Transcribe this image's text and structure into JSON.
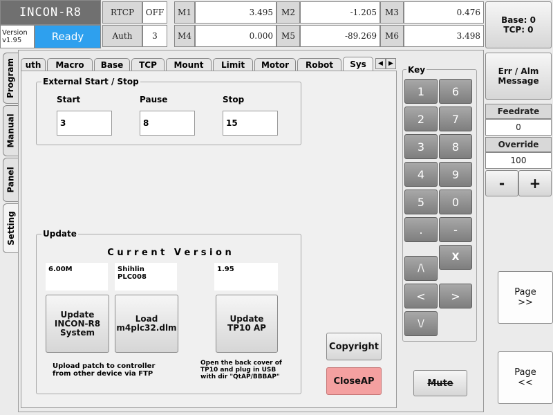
{
  "header": {
    "app_title": "INCON-R8",
    "version_label": "Version",
    "version": "v1.95",
    "status": "Ready",
    "rtcp_label": "RTCP",
    "rtcp_value": "OFF",
    "auth_label": "Auth",
    "auth_value": "3",
    "m1_label": "M1",
    "m1_value": "3.495",
    "m2_label": "M2",
    "m2_value": "-1.205",
    "m3_label": "M3",
    "m3_value": "0.476",
    "m4_label": "M4",
    "m4_value": "0.000",
    "m5_label": "M5",
    "m5_value": "-89.269",
    "m6_label": "M6",
    "m6_value": "3.498",
    "base_tcp": "Base: 0\nTCP: 0"
  },
  "side_tabs": [
    "Program",
    "Manual",
    "Panel",
    "Setting"
  ],
  "tabs": [
    "uth",
    "Macro",
    "Base",
    "TCP",
    "Mount",
    "Limit",
    "Motor",
    "Robot",
    "Sys"
  ],
  "external": {
    "title": "External Start / Stop",
    "start_label": "Start",
    "start_value": "3",
    "pause_label": "Pause",
    "pause_value": "8",
    "stop_label": "Stop",
    "stop_value": "15"
  },
  "update": {
    "title": "Update",
    "current_version": "C u r r e n t   V e r s i o n",
    "ver1": "6.00M",
    "ver2": "Shihlin PLC008",
    "ver3": "1.95",
    "btn1": "Update\nINCON-R8\nSystem",
    "btn2": "Load\nm4plc32.dlm",
    "btn3": "Update\nTP10 AP",
    "note1": "Upload patch to controller\nfrom other device via FTP",
    "note2": "Open the back cover of\nTP10 and plug in USB\nwith dir \"QtAP/BBBAP\""
  },
  "buttons": {
    "copyright": "Copyright",
    "close_ap": "CloseAP",
    "mute": "Mute"
  },
  "keypad": {
    "title": "Key",
    "keys": [
      "1",
      "6",
      "2",
      "7",
      "3",
      "8",
      "4",
      "9",
      "5",
      "0",
      ".",
      "-"
    ],
    "x": "X",
    "up": "/\\",
    "left": "<",
    "right": ">",
    "down": "\\/"
  },
  "right_panel": {
    "err_alm": "Err / Alm\nMessage",
    "feedrate_label": "Feedrate",
    "feedrate_value": "0",
    "override_label": "Override",
    "override_value": "100",
    "minus": "-",
    "plus": "+",
    "page_next": "Page\n>>",
    "page_prev": "Page\n<<"
  },
  "colors": {
    "ready": "#2ea0ee",
    "close_ap": "#f4a0a0",
    "key_gray": "#8e8e8e"
  }
}
